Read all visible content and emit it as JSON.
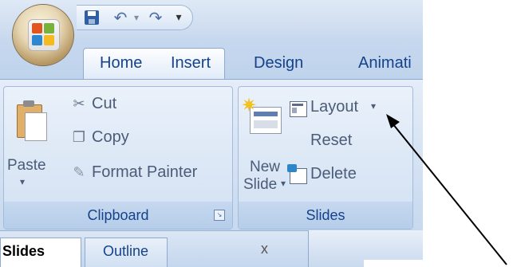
{
  "quick_access": {
    "save_icon": "save-icon",
    "undo_glyph": "↶",
    "redo_glyph": "↷",
    "customize_glyph": "▾"
  },
  "tabs": [
    "Home",
    "Insert",
    "Design",
    "Animati"
  ],
  "clipboard": {
    "paste_label": "Paste",
    "paste_arrow": "▾",
    "cut_label": "Cut",
    "copy_label": "Copy",
    "format_painter_label": "Format Painter",
    "group_label": "Clipboard",
    "launcher_glyph": "↘"
  },
  "slides": {
    "new_slide_label_line1": "New",
    "new_slide_label_line2": "Slide",
    "new_slide_arrow": "▾",
    "layout_label": "Layout",
    "layout_arrow": "▾",
    "reset_label": "Reset",
    "delete_label": "Delete",
    "group_label": "Slides"
  },
  "pane_tabs": {
    "slides_label": "Slides",
    "outline_label": "Outline",
    "close_glyph": "x"
  },
  "colors": {
    "ribbon_text": "#15428b",
    "annotation_arrow": "#000000"
  }
}
